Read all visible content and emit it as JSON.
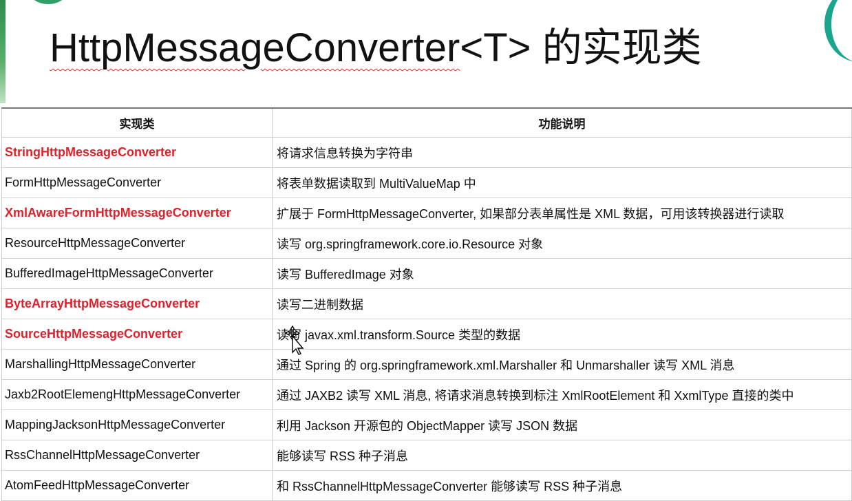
{
  "title": {
    "prefix": "HttpMessageConverter",
    "generic": "<T>",
    "suffix": " 的实现类"
  },
  "table": {
    "headers": [
      "实现类",
      "功能说明"
    ],
    "rows": [
      {
        "name": "StringHttpMessageConverter",
        "desc": "将请求信息转换为字符串",
        "highlight": true
      },
      {
        "name": "FormHttpMessageConverter",
        "desc": "将表单数据读取到 MultiValueMap 中",
        "highlight": false
      },
      {
        "name": "XmlAwareFormHttpMessageConverter",
        "desc": "扩展于 FormHttpMessageConverter, 如果部分表单属性是 XML 数据，可用该转换器进行读取",
        "highlight": true
      },
      {
        "name": "ResourceHttpMessageConverter",
        "desc": "读写 org.springframework.core.io.Resource 对象",
        "highlight": false
      },
      {
        "name": "BufferedImageHttpMessageConverter",
        "desc": "读写 BufferedImage 对象",
        "highlight": false
      },
      {
        "name": "ByteArrayHttpMessageConverter",
        "desc": "读写二进制数据",
        "highlight": true
      },
      {
        "name": "SourceHttpMessageConverter",
        "desc": "读写 javax.xml.transform.Source 类型的数据",
        "highlight": true
      },
      {
        "name": "MarshallingHttpMessageConverter",
        "desc": "通过 Spring 的 org.springframework.xml.Marshaller 和 Unmarshaller 读写 XML 消息",
        "highlight": false
      },
      {
        "name": "Jaxb2RootElemengHttpMessageConverter",
        "desc": "通过 JAXB2 读写 XML 消息, 将请求消息转换到标注 XmlRootElement 和 XxmlType 直接的类中",
        "highlight": false
      },
      {
        "name": "MappingJacksonHttpMessageConverter",
        "desc": "利用 Jackson 开源包的 ObjectMapper 读写 JSON 数据",
        "highlight": false
      },
      {
        "name": "RssChannelHttpMessageConverter",
        "desc": "能够读写 RSS 种子消息",
        "highlight": false
      },
      {
        "name": "AtomFeedHttpMessageConverter",
        "desc": "和 RssChannelHttpMessageConverter 能够读写 RSS 种子消息",
        "highlight": false
      }
    ]
  },
  "colors": {
    "highlight": "#e0202a",
    "text": "#111111",
    "accent_green": "#2f9f6a"
  },
  "icons": {
    "cursor": "move-cursor-icon"
  }
}
